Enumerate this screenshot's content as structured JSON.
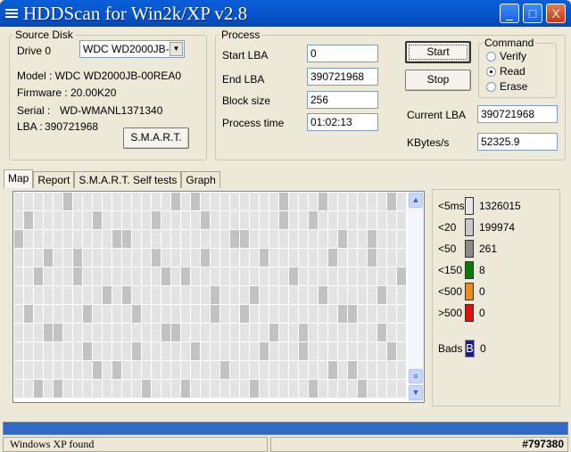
{
  "window": {
    "title": "HDDScan for Win2k/XP  v2.8",
    "minimize": "_",
    "maximize": "□",
    "close": "X"
  },
  "source_disk": {
    "legend": "Source Disk",
    "drive_label": "Drive  0",
    "drive_select": "WDC WD2000JB-0(",
    "model": "Model : WDC WD2000JB-00REA0",
    "firmware": "Firmware : 20.00K20",
    "serial_label": "Serial :",
    "serial": "WD-WMANL1371340",
    "lba_label": "LBA :",
    "lba": "390721968",
    "smart_button": "S.M.A.R.T."
  },
  "process": {
    "legend": "Process",
    "start_lba_label": "Start LBA",
    "start_lba": "0",
    "end_lba_label": "End LBA",
    "end_lba": "390721968",
    "block_size_label": "Block size",
    "block_size": "256",
    "process_time_label": "Process time",
    "process_time": "01:02:13",
    "start_button": "Start",
    "stop_button": "Stop",
    "current_lba_label": "Current LBA",
    "current_lba": "390721968",
    "kbytes_label": "KBytes/s",
    "kbytes": "52325.9"
  },
  "command": {
    "legend": "Command",
    "options": [
      "Verify",
      "Read",
      "Erase"
    ],
    "selected": "Read"
  },
  "tabs": [
    "Map",
    "Report",
    "S.M.A.R.T. Self tests",
    "Graph"
  ],
  "legend": {
    "rows": [
      {
        "label": "<5ms",
        "count": "1326015",
        "color": "#e6e6e6"
      },
      {
        "label": "<20",
        "count": "199974",
        "color": "#c8c8c8"
      },
      {
        "label": "<50",
        "count": "261",
        "color": "#8c8c8c"
      },
      {
        "label": "<150",
        "count": "8",
        "color": "#0a7a0a"
      },
      {
        "label": "<500",
        "count": "0",
        "color": "#f08a1c"
      },
      {
        "label": ">500",
        "count": "0",
        "color": "#e01010"
      }
    ],
    "bads_label": "Bads",
    "bads_icon": "B",
    "bads_count": "0"
  },
  "progress": {
    "percent": 100
  },
  "status": {
    "text": "Windows XP found",
    "code": "#797380"
  }
}
